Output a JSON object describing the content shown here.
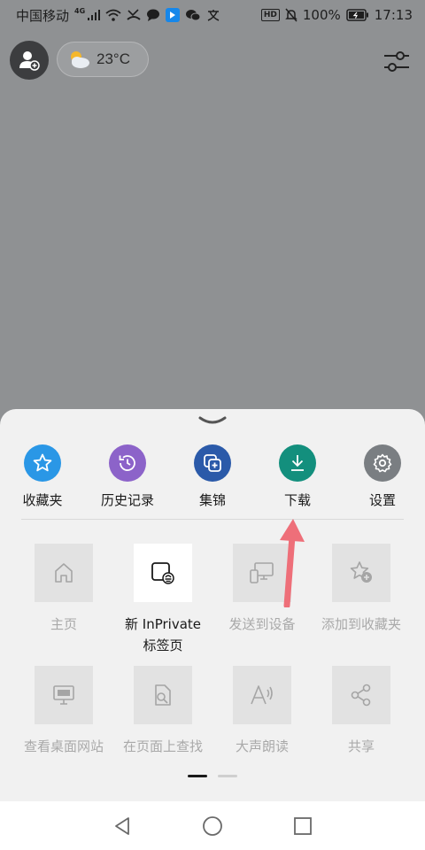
{
  "status_bar": {
    "carrier": "中国移动",
    "network": "4G",
    "battery": "100%",
    "time": "17:13",
    "hd_badge": "HD"
  },
  "header": {
    "weather_temp": "23°C"
  },
  "colors": {
    "favorites": "#2a97e6",
    "history": "#8c63c9",
    "collections": "#2b5aa9",
    "downloads": "#138f7d",
    "settings": "#7a7e82",
    "arrow": "#ee6f79"
  },
  "top_actions": [
    {
      "label": "收藏夹",
      "icon": "star-icon"
    },
    {
      "label": "历史记录",
      "icon": "history-icon"
    },
    {
      "label": "集锦",
      "icon": "collections-icon"
    },
    {
      "label": "下载",
      "icon": "download-icon"
    },
    {
      "label": "设置",
      "icon": "gear-icon"
    }
  ],
  "grid_items": [
    {
      "label": "主页",
      "icon": "home-icon"
    },
    {
      "label_line1": "新 InPrivate",
      "label_line2": "标签页",
      "icon": "inprivate-icon"
    },
    {
      "label": "发送到设备",
      "icon": "devices-icon"
    },
    {
      "label": "添加到收藏夹",
      "icon": "star-add-icon"
    },
    {
      "label": "查看桌面网站",
      "icon": "monitor-icon"
    },
    {
      "label": "在页面上查找",
      "icon": "find-in-page-icon"
    },
    {
      "label": "大声朗读",
      "icon": "read-aloud-icon"
    },
    {
      "label": "共享",
      "icon": "share-icon"
    }
  ],
  "pager": {
    "pages": 2,
    "current": 1
  }
}
